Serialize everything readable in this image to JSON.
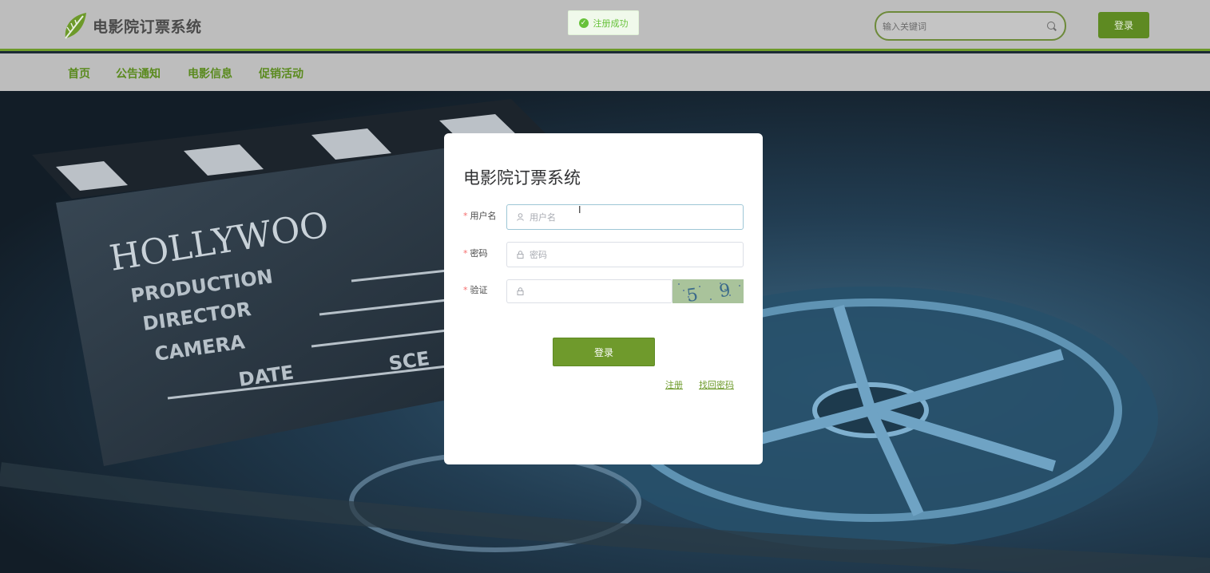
{
  "brand": {
    "title": "电影院订票系统",
    "icon": "leaf-icon"
  },
  "toast": {
    "message": "注册成功",
    "icon": "check-circle-icon"
  },
  "search": {
    "placeholder": "输入关键词",
    "icon": "search-icon"
  },
  "header": {
    "login_label": "登录"
  },
  "nav": {
    "items": [
      {
        "label": "首页"
      },
      {
        "label": "公告通知"
      },
      {
        "label": "电影信息"
      },
      {
        "label": "促销活动"
      }
    ]
  },
  "hero": {
    "slate_lines": [
      "HOLLYWOO",
      "PRODUCTION",
      "DIRECTOR",
      "CAMERA",
      "DATE",
      "SCE"
    ]
  },
  "login_form": {
    "title": "电影院订票系统",
    "username": {
      "label": "用户名",
      "placeholder": "用户名",
      "icon": "user-icon"
    },
    "password": {
      "label": "密码",
      "placeholder": "密码",
      "icon": "lock-icon"
    },
    "captcha": {
      "label": "验证",
      "placeholder": "",
      "icon": "lock-icon",
      "code": "5 9 4"
    },
    "submit_label": "登录",
    "register_link": "注册",
    "forgot_link": "找回密码"
  },
  "colors": {
    "accent": "#6f9a2c",
    "header_bg": "#bdbdbd",
    "toast_success": "#67c23a",
    "required": "#f56c6c"
  }
}
